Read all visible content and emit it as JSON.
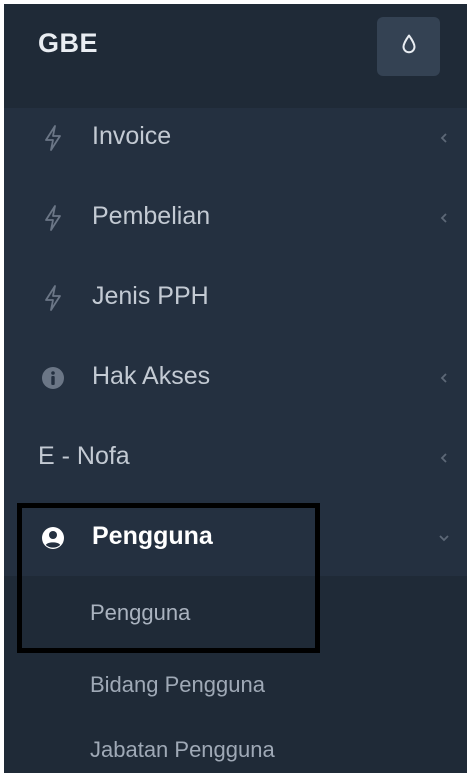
{
  "brand": {
    "title": "GBE",
    "theme_icon": "droplet-icon"
  },
  "menu": [
    {
      "label": "Invoice",
      "icon": "bolt-icon",
      "expandable": true
    },
    {
      "label": "Pembelian",
      "icon": "bolt-icon",
      "expandable": true
    },
    {
      "label": "Jenis PPH",
      "icon": "bolt-icon",
      "expandable": false
    },
    {
      "label": "Hak Akses",
      "icon": "info-circle-icon",
      "expandable": true
    },
    {
      "label": "E - Nofa",
      "icon": "",
      "expandable": true
    },
    {
      "label": "Pengguna",
      "icon": "user-circle-icon",
      "expandable": true,
      "expanded": true
    }
  ],
  "submenu": [
    {
      "label": "Pengguna"
    },
    {
      "label": "Bidang Pengguna"
    },
    {
      "label": "Jabatan Pengguna"
    }
  ],
  "colors": {
    "sidebar_bg": "#243040",
    "header_bg": "#1f2a37",
    "text": "#c3cad3",
    "active_text": "#ffffff",
    "highlight_border": "#000000"
  }
}
